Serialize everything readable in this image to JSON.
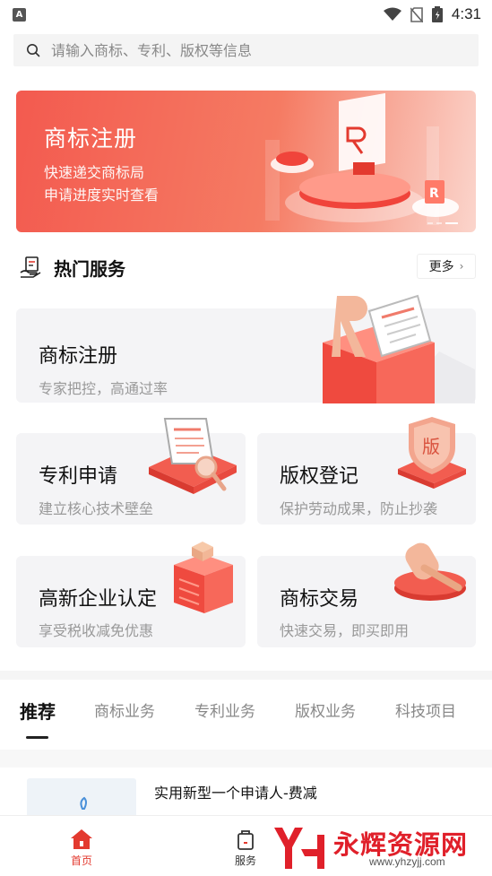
{
  "status_bar": {
    "time": "4:31",
    "notification_letter": "A"
  },
  "search": {
    "placeholder": "请输入商标、专利、版权等信息"
  },
  "banner": {
    "title": "商标注册",
    "line1": "快速递交商标局",
    "line2": "申请进度实时查看"
  },
  "hot_services": {
    "title": "热门服务",
    "more_label": "更多"
  },
  "cards": [
    {
      "title": "商标注册",
      "subtitle": "专家把控，高通过率",
      "icon": "trademark-r-icon"
    },
    {
      "title": "专利申请",
      "subtitle": "建立核心技术壁垒",
      "icon": "patent-document-icon"
    },
    {
      "title": "版权登记",
      "subtitle": "保护劳动成果，防止抄袭",
      "icon": "copyright-shield-icon",
      "badge": "版"
    },
    {
      "title": "高新企业认定",
      "subtitle": "享受税收减免优惠",
      "icon": "enterprise-building-icon"
    },
    {
      "title": "商标交易",
      "subtitle": "快速交易，即买即用",
      "icon": "gavel-icon"
    }
  ],
  "tabs": [
    {
      "label": "推荐",
      "active": true
    },
    {
      "label": "商标业务",
      "active": false
    },
    {
      "label": "专利业务",
      "active": false
    },
    {
      "label": "版权业务",
      "active": false
    },
    {
      "label": "科技项目",
      "active": false
    }
  ],
  "recommendation": {
    "title": "实用新型一个申请人-费减"
  },
  "bottom_nav": [
    {
      "label": "首页",
      "icon": "home-icon",
      "active": true
    },
    {
      "label": "服务",
      "icon": "bag-icon",
      "active": false
    }
  ],
  "watermark": {
    "text": "永辉资源网",
    "url": "www.yhzyjj.com"
  },
  "colors": {
    "accent": "#e33a2f",
    "banner_start": "#f35a4f",
    "card_bg": "#f4f4f6"
  }
}
